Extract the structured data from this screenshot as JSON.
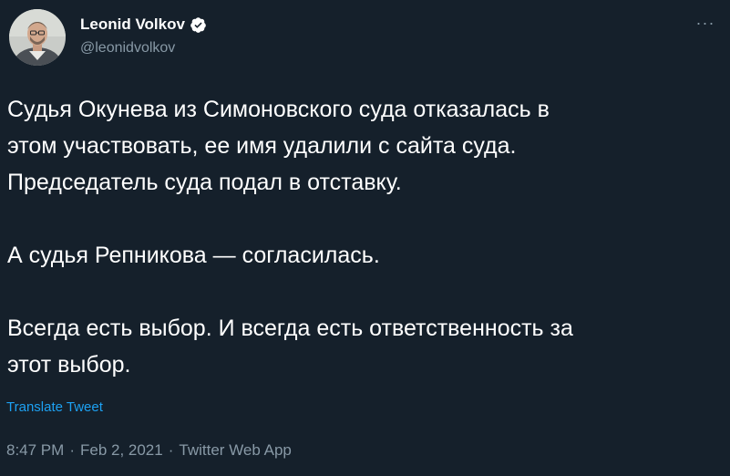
{
  "author": {
    "display_name": "Leonid Volkov",
    "handle": "@leonidvolkov",
    "verified_icon": "verified-badge-icon",
    "avatar_icon": "avatar-photo"
  },
  "more_button": {
    "icon": "more-dots-icon",
    "label": "···"
  },
  "tweet": {
    "paragraphs": [
      "Судья Окунева из Симоновского суда отказалась в\nэтом участвовать, ее имя удалили с сайта суда.\nПредседатель суда подал в отставку.",
      "А судья Репникова — согласилась.",
      "Всегда есть выбор. И всегда есть ответственность за\nэтот выбор."
    ],
    "translate_label": "Translate Tweet",
    "time": "8:47 PM",
    "date": "Feb 2, 2021",
    "source": "Twitter Web App",
    "separator": "·"
  },
  "colors": {
    "background": "#15202b",
    "text": "#ffffff",
    "secondary": "#8899a6",
    "accent": "#1da1f2"
  }
}
